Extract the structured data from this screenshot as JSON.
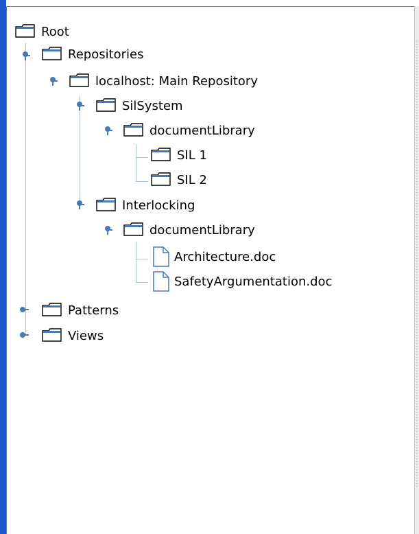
{
  "tree": {
    "root": "Root",
    "repositories": "Repositories",
    "localhost": "localhost: Main Repository",
    "silsystem": "SilSystem",
    "silsystem_doclib": "documentLibrary",
    "sil1": "SIL 1",
    "sil2": "SIL 2",
    "interlocking": "Interlocking",
    "interlocking_doclib": "documentLibrary",
    "architecture": "Architecture.doc",
    "safety": "SafetyArgumentation.doc",
    "patterns": "Patterns",
    "views": "Views"
  },
  "icons": {
    "folder": "folder-icon",
    "document": "document-icon",
    "expanded": "expanded-handle-icon",
    "collapsed": "collapsed-handle-icon"
  },
  "colors": {
    "accent_edge": "#1c59c6",
    "tree_line": "#a9bfd6",
    "handle": "#4a78b6"
  }
}
